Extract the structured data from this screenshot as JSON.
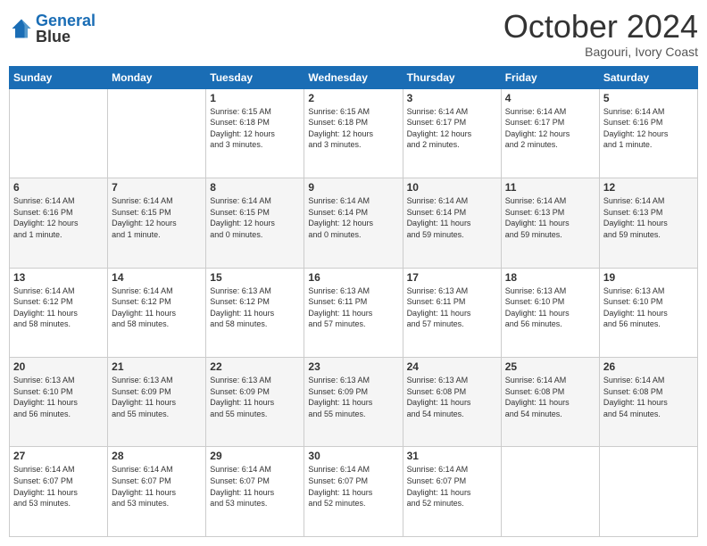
{
  "header": {
    "logo_line1": "General",
    "logo_line2": "Blue",
    "month": "October 2024",
    "location": "Bagouri, Ivory Coast"
  },
  "weekdays": [
    "Sunday",
    "Monday",
    "Tuesday",
    "Wednesday",
    "Thursday",
    "Friday",
    "Saturday"
  ],
  "weeks": [
    [
      {
        "day": "",
        "info": ""
      },
      {
        "day": "",
        "info": ""
      },
      {
        "day": "1",
        "info": "Sunrise: 6:15 AM\nSunset: 6:18 PM\nDaylight: 12 hours\nand 3 minutes."
      },
      {
        "day": "2",
        "info": "Sunrise: 6:15 AM\nSunset: 6:18 PM\nDaylight: 12 hours\nand 3 minutes."
      },
      {
        "day": "3",
        "info": "Sunrise: 6:14 AM\nSunset: 6:17 PM\nDaylight: 12 hours\nand 2 minutes."
      },
      {
        "day": "4",
        "info": "Sunrise: 6:14 AM\nSunset: 6:17 PM\nDaylight: 12 hours\nand 2 minutes."
      },
      {
        "day": "5",
        "info": "Sunrise: 6:14 AM\nSunset: 6:16 PM\nDaylight: 12 hours\nand 1 minute."
      }
    ],
    [
      {
        "day": "6",
        "info": "Sunrise: 6:14 AM\nSunset: 6:16 PM\nDaylight: 12 hours\nand 1 minute."
      },
      {
        "day": "7",
        "info": "Sunrise: 6:14 AM\nSunset: 6:15 PM\nDaylight: 12 hours\nand 1 minute."
      },
      {
        "day": "8",
        "info": "Sunrise: 6:14 AM\nSunset: 6:15 PM\nDaylight: 12 hours\nand 0 minutes."
      },
      {
        "day": "9",
        "info": "Sunrise: 6:14 AM\nSunset: 6:14 PM\nDaylight: 12 hours\nand 0 minutes."
      },
      {
        "day": "10",
        "info": "Sunrise: 6:14 AM\nSunset: 6:14 PM\nDaylight: 11 hours\nand 59 minutes."
      },
      {
        "day": "11",
        "info": "Sunrise: 6:14 AM\nSunset: 6:13 PM\nDaylight: 11 hours\nand 59 minutes."
      },
      {
        "day": "12",
        "info": "Sunrise: 6:14 AM\nSunset: 6:13 PM\nDaylight: 11 hours\nand 59 minutes."
      }
    ],
    [
      {
        "day": "13",
        "info": "Sunrise: 6:14 AM\nSunset: 6:12 PM\nDaylight: 11 hours\nand 58 minutes."
      },
      {
        "day": "14",
        "info": "Sunrise: 6:14 AM\nSunset: 6:12 PM\nDaylight: 11 hours\nand 58 minutes."
      },
      {
        "day": "15",
        "info": "Sunrise: 6:13 AM\nSunset: 6:12 PM\nDaylight: 11 hours\nand 58 minutes."
      },
      {
        "day": "16",
        "info": "Sunrise: 6:13 AM\nSunset: 6:11 PM\nDaylight: 11 hours\nand 57 minutes."
      },
      {
        "day": "17",
        "info": "Sunrise: 6:13 AM\nSunset: 6:11 PM\nDaylight: 11 hours\nand 57 minutes."
      },
      {
        "day": "18",
        "info": "Sunrise: 6:13 AM\nSunset: 6:10 PM\nDaylight: 11 hours\nand 56 minutes."
      },
      {
        "day": "19",
        "info": "Sunrise: 6:13 AM\nSunset: 6:10 PM\nDaylight: 11 hours\nand 56 minutes."
      }
    ],
    [
      {
        "day": "20",
        "info": "Sunrise: 6:13 AM\nSunset: 6:10 PM\nDaylight: 11 hours\nand 56 minutes."
      },
      {
        "day": "21",
        "info": "Sunrise: 6:13 AM\nSunset: 6:09 PM\nDaylight: 11 hours\nand 55 minutes."
      },
      {
        "day": "22",
        "info": "Sunrise: 6:13 AM\nSunset: 6:09 PM\nDaylight: 11 hours\nand 55 minutes."
      },
      {
        "day": "23",
        "info": "Sunrise: 6:13 AM\nSunset: 6:09 PM\nDaylight: 11 hours\nand 55 minutes."
      },
      {
        "day": "24",
        "info": "Sunrise: 6:13 AM\nSunset: 6:08 PM\nDaylight: 11 hours\nand 54 minutes."
      },
      {
        "day": "25",
        "info": "Sunrise: 6:14 AM\nSunset: 6:08 PM\nDaylight: 11 hours\nand 54 minutes."
      },
      {
        "day": "26",
        "info": "Sunrise: 6:14 AM\nSunset: 6:08 PM\nDaylight: 11 hours\nand 54 minutes."
      }
    ],
    [
      {
        "day": "27",
        "info": "Sunrise: 6:14 AM\nSunset: 6:07 PM\nDaylight: 11 hours\nand 53 minutes."
      },
      {
        "day": "28",
        "info": "Sunrise: 6:14 AM\nSunset: 6:07 PM\nDaylight: 11 hours\nand 53 minutes."
      },
      {
        "day": "29",
        "info": "Sunrise: 6:14 AM\nSunset: 6:07 PM\nDaylight: 11 hours\nand 53 minutes."
      },
      {
        "day": "30",
        "info": "Sunrise: 6:14 AM\nSunset: 6:07 PM\nDaylight: 11 hours\nand 52 minutes."
      },
      {
        "day": "31",
        "info": "Sunrise: 6:14 AM\nSunset: 6:07 PM\nDaylight: 11 hours\nand 52 minutes."
      },
      {
        "day": "",
        "info": ""
      },
      {
        "day": "",
        "info": ""
      }
    ]
  ]
}
